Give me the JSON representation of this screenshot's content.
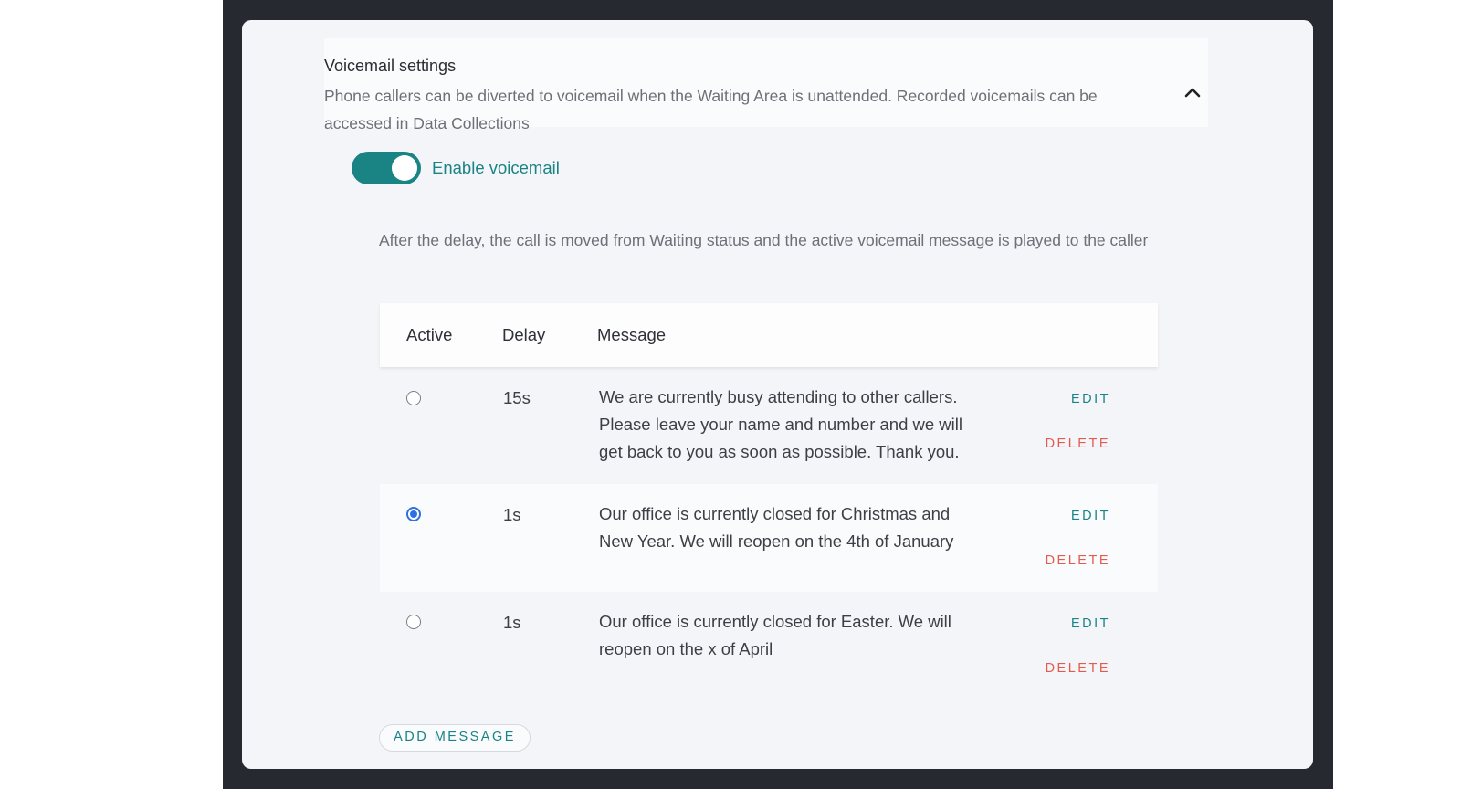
{
  "voicemail": {
    "title": "Voicemail settings",
    "description": "Phone callers can be diverted to voicemail when the Waiting Area is unattended. Recorded voicemails can be accessed in Data Collections",
    "collapse_icon": "chevron-up-icon",
    "enable_label": "Enable voicemail",
    "enabled": true,
    "info": "After the delay, the call is moved from Waiting status and the active voicemail message is played to the caller"
  },
  "table": {
    "headers": {
      "active": "Active",
      "delay": "Delay",
      "message": "Message"
    },
    "rows": [
      {
        "active": false,
        "delay": "15s",
        "message": "We are currently busy attending to other callers. Please leave your name and number and we will get back to you as soon as possible. Thank you.",
        "edit": "EDIT",
        "delete": "DELETE"
      },
      {
        "active": true,
        "delay": "1s",
        "message": "Our office is currently closed for Christmas and New Year. We will reopen on the 4th of January",
        "edit": "EDIT",
        "delete": "DELETE"
      },
      {
        "active": false,
        "delay": "1s",
        "message": "Our office is currently closed for Easter. We will reopen on the x of April",
        "edit": "EDIT",
        "delete": "DELETE"
      }
    ]
  },
  "add_message_label": "ADD MESSAGE",
  "colors": {
    "accent": "#1a8384",
    "danger": "#e35b4f",
    "radio_selected": "#2f6fe4",
    "frame": "#262a30"
  }
}
